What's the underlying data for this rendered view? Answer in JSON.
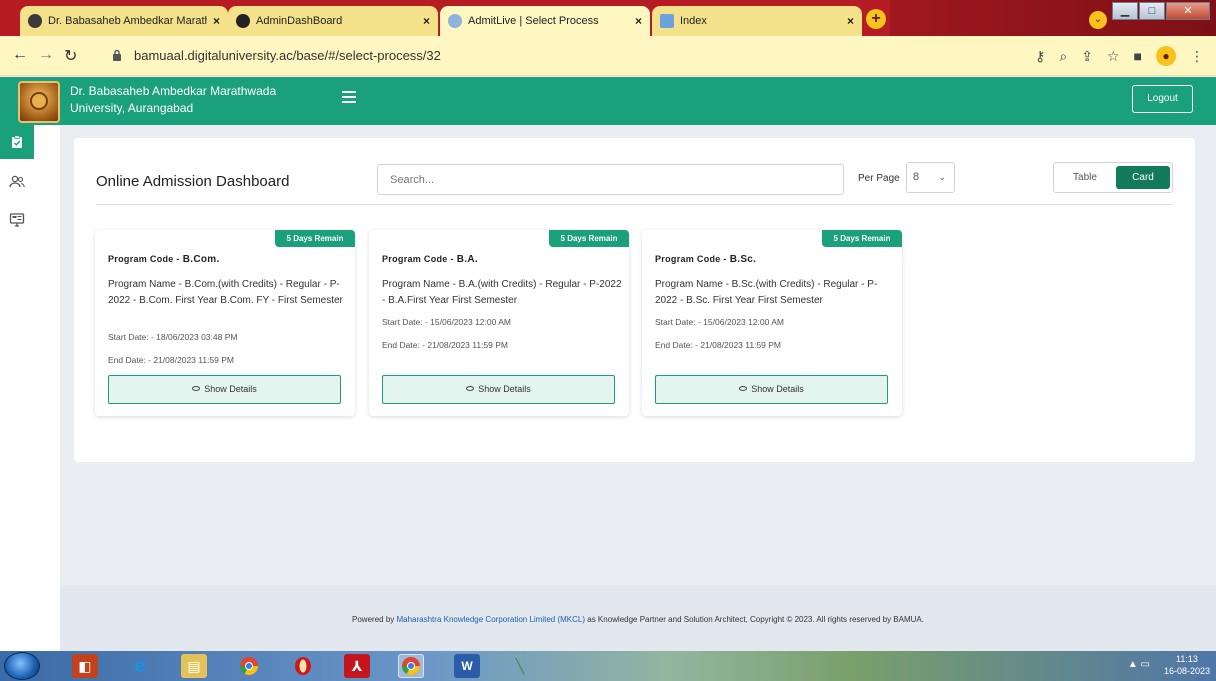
{
  "browser": {
    "tabs": [
      {
        "label": "Dr. Babasaheb Ambedkar Marath",
        "close": "×",
        "favicon_color": "#3a3a3a"
      },
      {
        "label": "AdminDashBoard",
        "close": "×",
        "favicon_color": "#222222"
      },
      {
        "label": "AdmitLive | Select Process",
        "close": "×",
        "favicon_color": "#8fb3d9"
      },
      {
        "label": "Index",
        "close": "×",
        "favicon_color": "#6aa3de"
      }
    ],
    "new_tab": "+",
    "url": "bamuaal.digitaluniversity.ac/base/#/select-process/32"
  },
  "header": {
    "university_name": "Dr. Babasaheb Ambedkar Marathwada University, Aurangabad",
    "logout_label": "Logout"
  },
  "dashboard": {
    "title": "Online Admission Dashboard",
    "search_placeholder": "Search...",
    "per_page_label": "Per Page",
    "per_page_value": "8",
    "view_table": "Table",
    "view_card": "Card"
  },
  "cards": [
    {
      "badge": "5 Days Remain",
      "code_label": "Program Code -",
      "code": "B.Com.",
      "name": "Program Name - B.Com.(with Credits) - Regular - P-2022 - B.Com. First Year B.Com. FY - First Semester",
      "start": "Start Date: - 18/06/2023 03:48 PM",
      "end": "End Date: - 21/08/2023 11:59 PM",
      "button": "Show Details"
    },
    {
      "badge": "5 Days Remain",
      "code_label": "Program Code -",
      "code": "B.A.",
      "name": "Program Name - B.A.(with Credits) - Regular - P-2022 - B.A.First Year First Semester",
      "start": "Start Date: - 15/06/2023 12:00 AM",
      "end": "End Date: - 21/08/2023 11:59 PM",
      "button": "Show Details"
    },
    {
      "badge": "5 Days Remain",
      "code_label": "Program Code -",
      "code": "B.Sc.",
      "name": "Program Name - B.Sc.(with Credits) - Regular - P-2022 - B.Sc. First Year First Semester",
      "start": "Start Date: - 15/06/2023 12:00 AM",
      "end": "End Date: - 21/08/2023 11:59 PM",
      "button": "Show Details"
    }
  ],
  "footer": {
    "prefix": "Powered by ",
    "link": "Maharashtra Knowledge Corporation Limited (MKCL)",
    "suffix": " as Knowledge Partner and Solution Architect, Copyright © 2023. All rights reserved by BAMUA."
  },
  "taskbar": {
    "time": "11:13",
    "date": "16-08-2023"
  },
  "colors": {
    "brand_green": "#1aa07b",
    "card_button_active": "#137a5a",
    "browser_frame": "#b51c24"
  }
}
